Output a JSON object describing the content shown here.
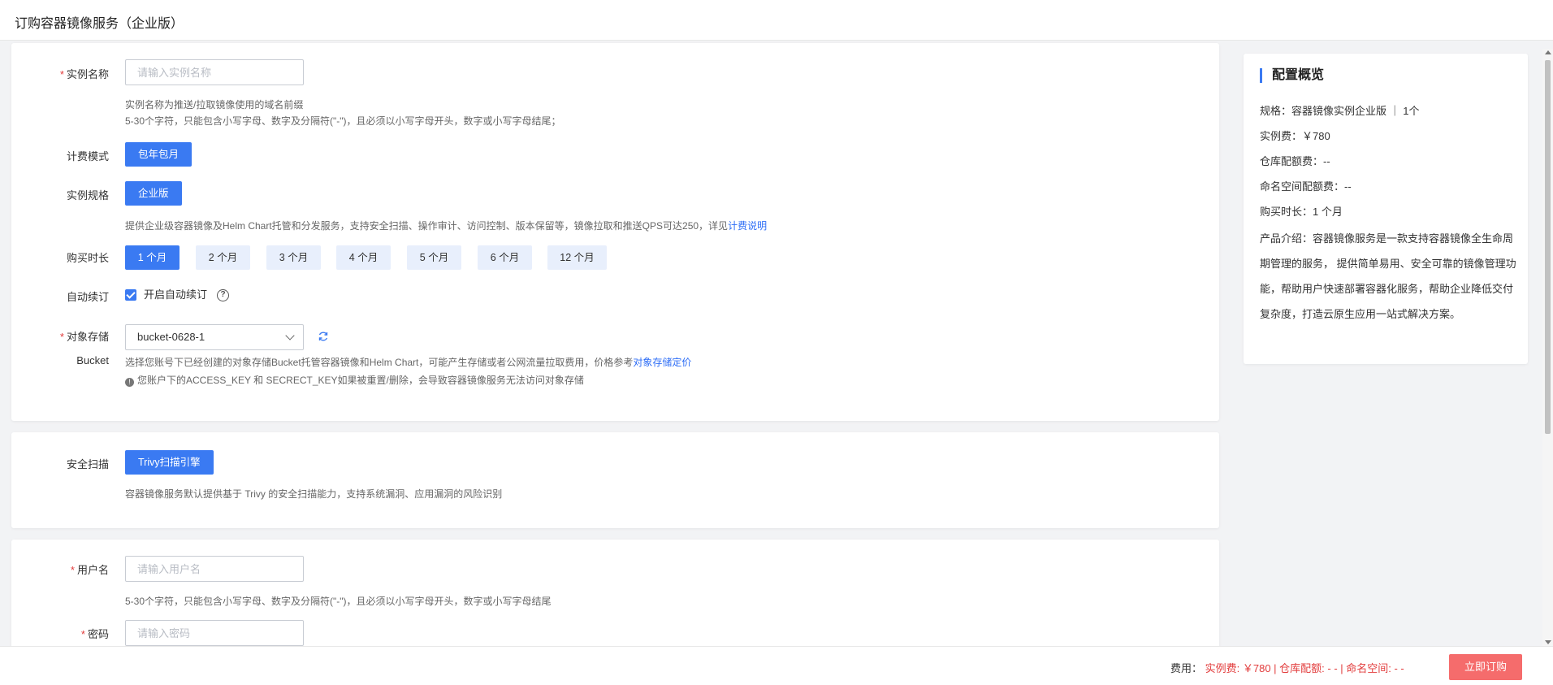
{
  "page": {
    "title": "订购容器镜像服务（企业版）"
  },
  "form": {
    "instance_name": {
      "label": "实例名称",
      "placeholder": "请输入实例名称",
      "hint1": "实例名称为推送/拉取镜像使用的域名前缀",
      "hint2": "5-30个字符，只能包含小写字母、数字及分隔符(\"-\")，且必须以小写字母开头，数字或小写字母结尾；"
    },
    "billing": {
      "label": "计费模式",
      "value": "包年包月"
    },
    "spec": {
      "label": "实例规格",
      "value": "企业版",
      "hint": "提供企业级容器镜像及Helm Chart托管和分发服务，支持安全扫描、操作审计、访问控制、版本保留等，镜像拉取和推送QPS可达250，详见",
      "hint_link": "计费说明"
    },
    "duration": {
      "label": "购买时长",
      "options": [
        "1 个月",
        "2 个月",
        "3 个月",
        "4 个月",
        "5 个月",
        "6 个月",
        "12 个月"
      ],
      "selected": "1 个月"
    },
    "auto_renew": {
      "label": "自动续订",
      "checkbox_label": "开启自动续订",
      "checked": true
    },
    "bucket": {
      "label_line1": "对象存储",
      "label_line2": "Bucket",
      "value": "bucket-0628-1",
      "hint": "选择您账号下已经创建的对象存储Bucket托管容器镜像和Helm Chart，可能产生存储或者公网流量拉取费用，价格参考",
      "hint_link": "对象存储定价",
      "warning": "您账户下的ACCESS_KEY 和 SECRECT_KEY如果被重置/删除，会导致容器镜像服务无法访问对象存储"
    },
    "security_scan": {
      "label": "安全扫描",
      "value": "Trivy扫描引擎",
      "hint": "容器镜像服务默认提供基于 Trivy 的安全扫描能力，支持系统漏洞、应用漏洞的风险识别"
    },
    "username": {
      "label": "用户名",
      "placeholder": "请输入用户名",
      "hint": "5-30个字符，只能包含小写字母、数字及分隔符(\"-\")，且必须以小写字母开头，数字或小写字母结尾"
    },
    "password": {
      "label": "密码",
      "placeholder": "请输入密码"
    }
  },
  "summary": {
    "title": "配置概览",
    "spec": "规格：容器镜像实例企业版 ｜ 1个",
    "instance_fee": "实例费：￥780",
    "repo_fee": "仓库配额费：--",
    "namespace_fee": "命名空间配额费：--",
    "duration": "购买时长：1 个月",
    "intro": "产品介绍：容器镜像服务是一款支持容器镜像全生命周期管理的服务， 提供简单易用、安全可靠的镜像管理功能，帮助用户快速部署容器化服务，帮助企业降低交付复杂度，打造云原生应用一站式解决方案。"
  },
  "footer": {
    "fee_label": "费用：",
    "fee_detail": "实例费: ￥780 | 仓库配额: - - | 命名空间: - -",
    "order_button": "立即订购"
  },
  "colors": {
    "primary": "#3a7af2",
    "danger": "#f56c6c",
    "required": "#e23c3c"
  }
}
